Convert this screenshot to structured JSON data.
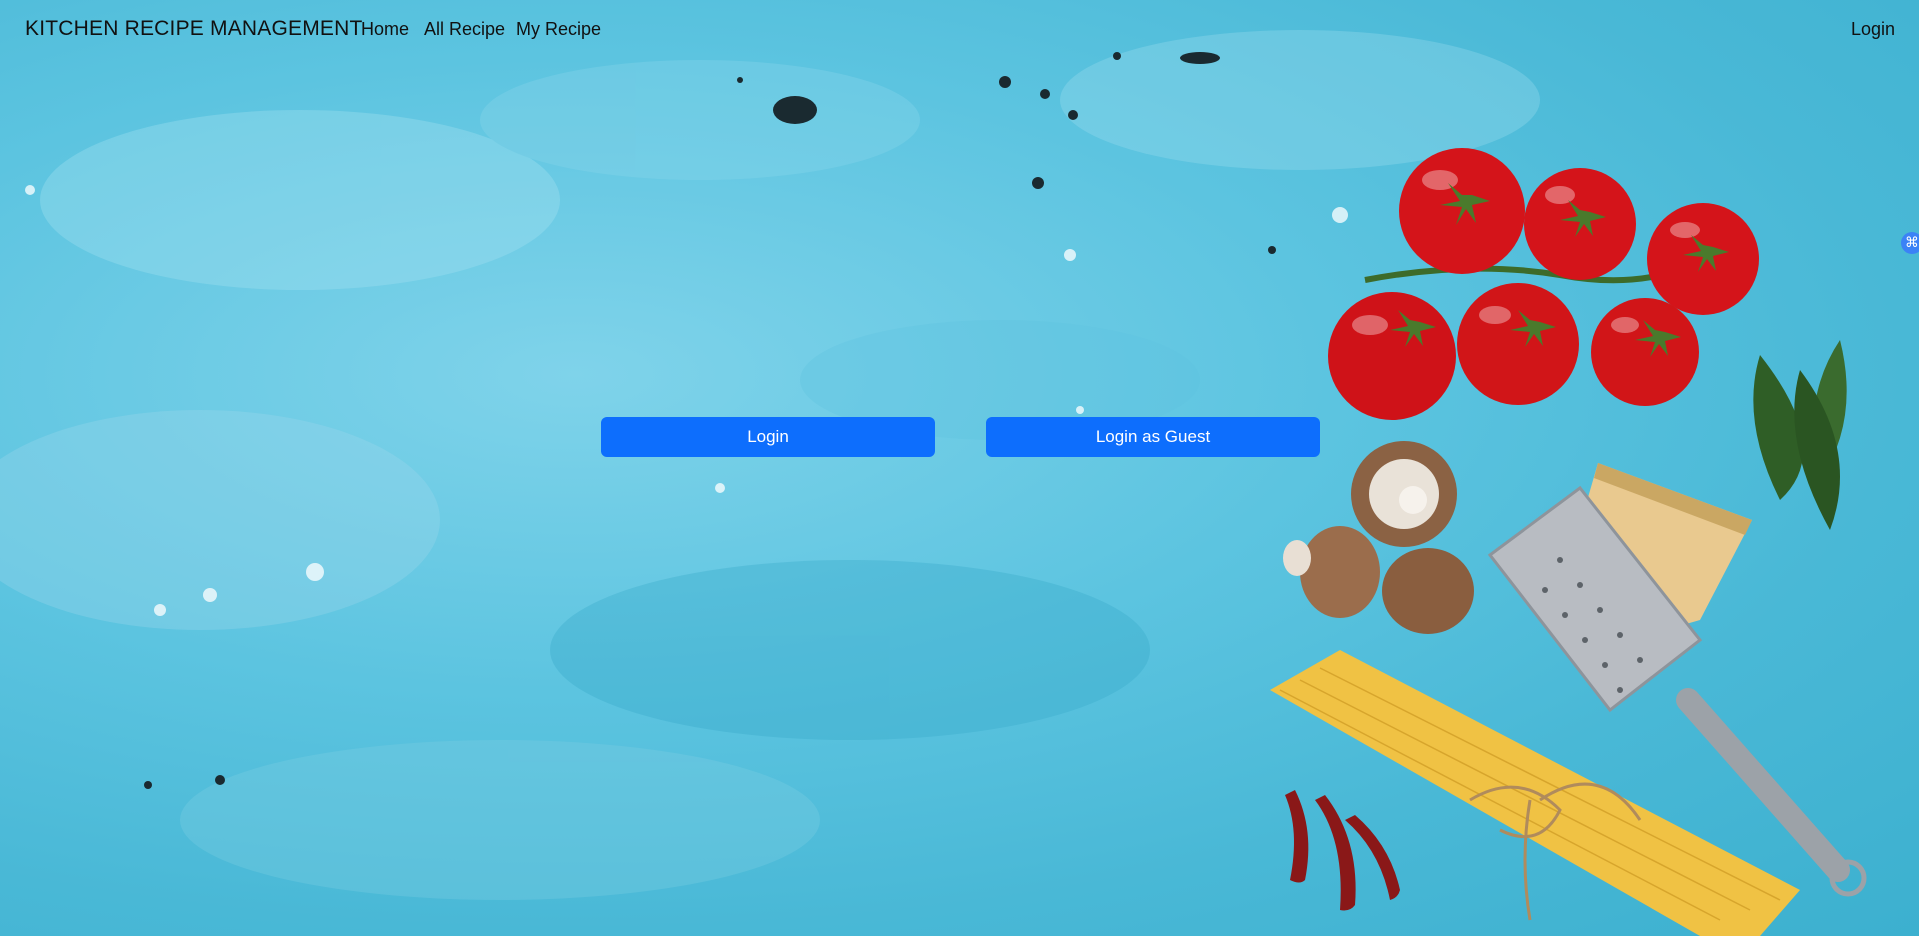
{
  "navbar": {
    "brand": "KITCHEN RECIPE MANAGEMENT",
    "links": [
      "Home",
      "All Recipe",
      "My Recipe"
    ],
    "login_label": "Login"
  },
  "main": {
    "login_button_label": "Login",
    "guest_button_label": "Login as Guest"
  },
  "side_widget": {
    "icon": "command-icon",
    "glyph": "⌘"
  },
  "colors": {
    "primary": "#0d6efd",
    "background": "#5cc4e0",
    "tomato": "#d4141a"
  }
}
